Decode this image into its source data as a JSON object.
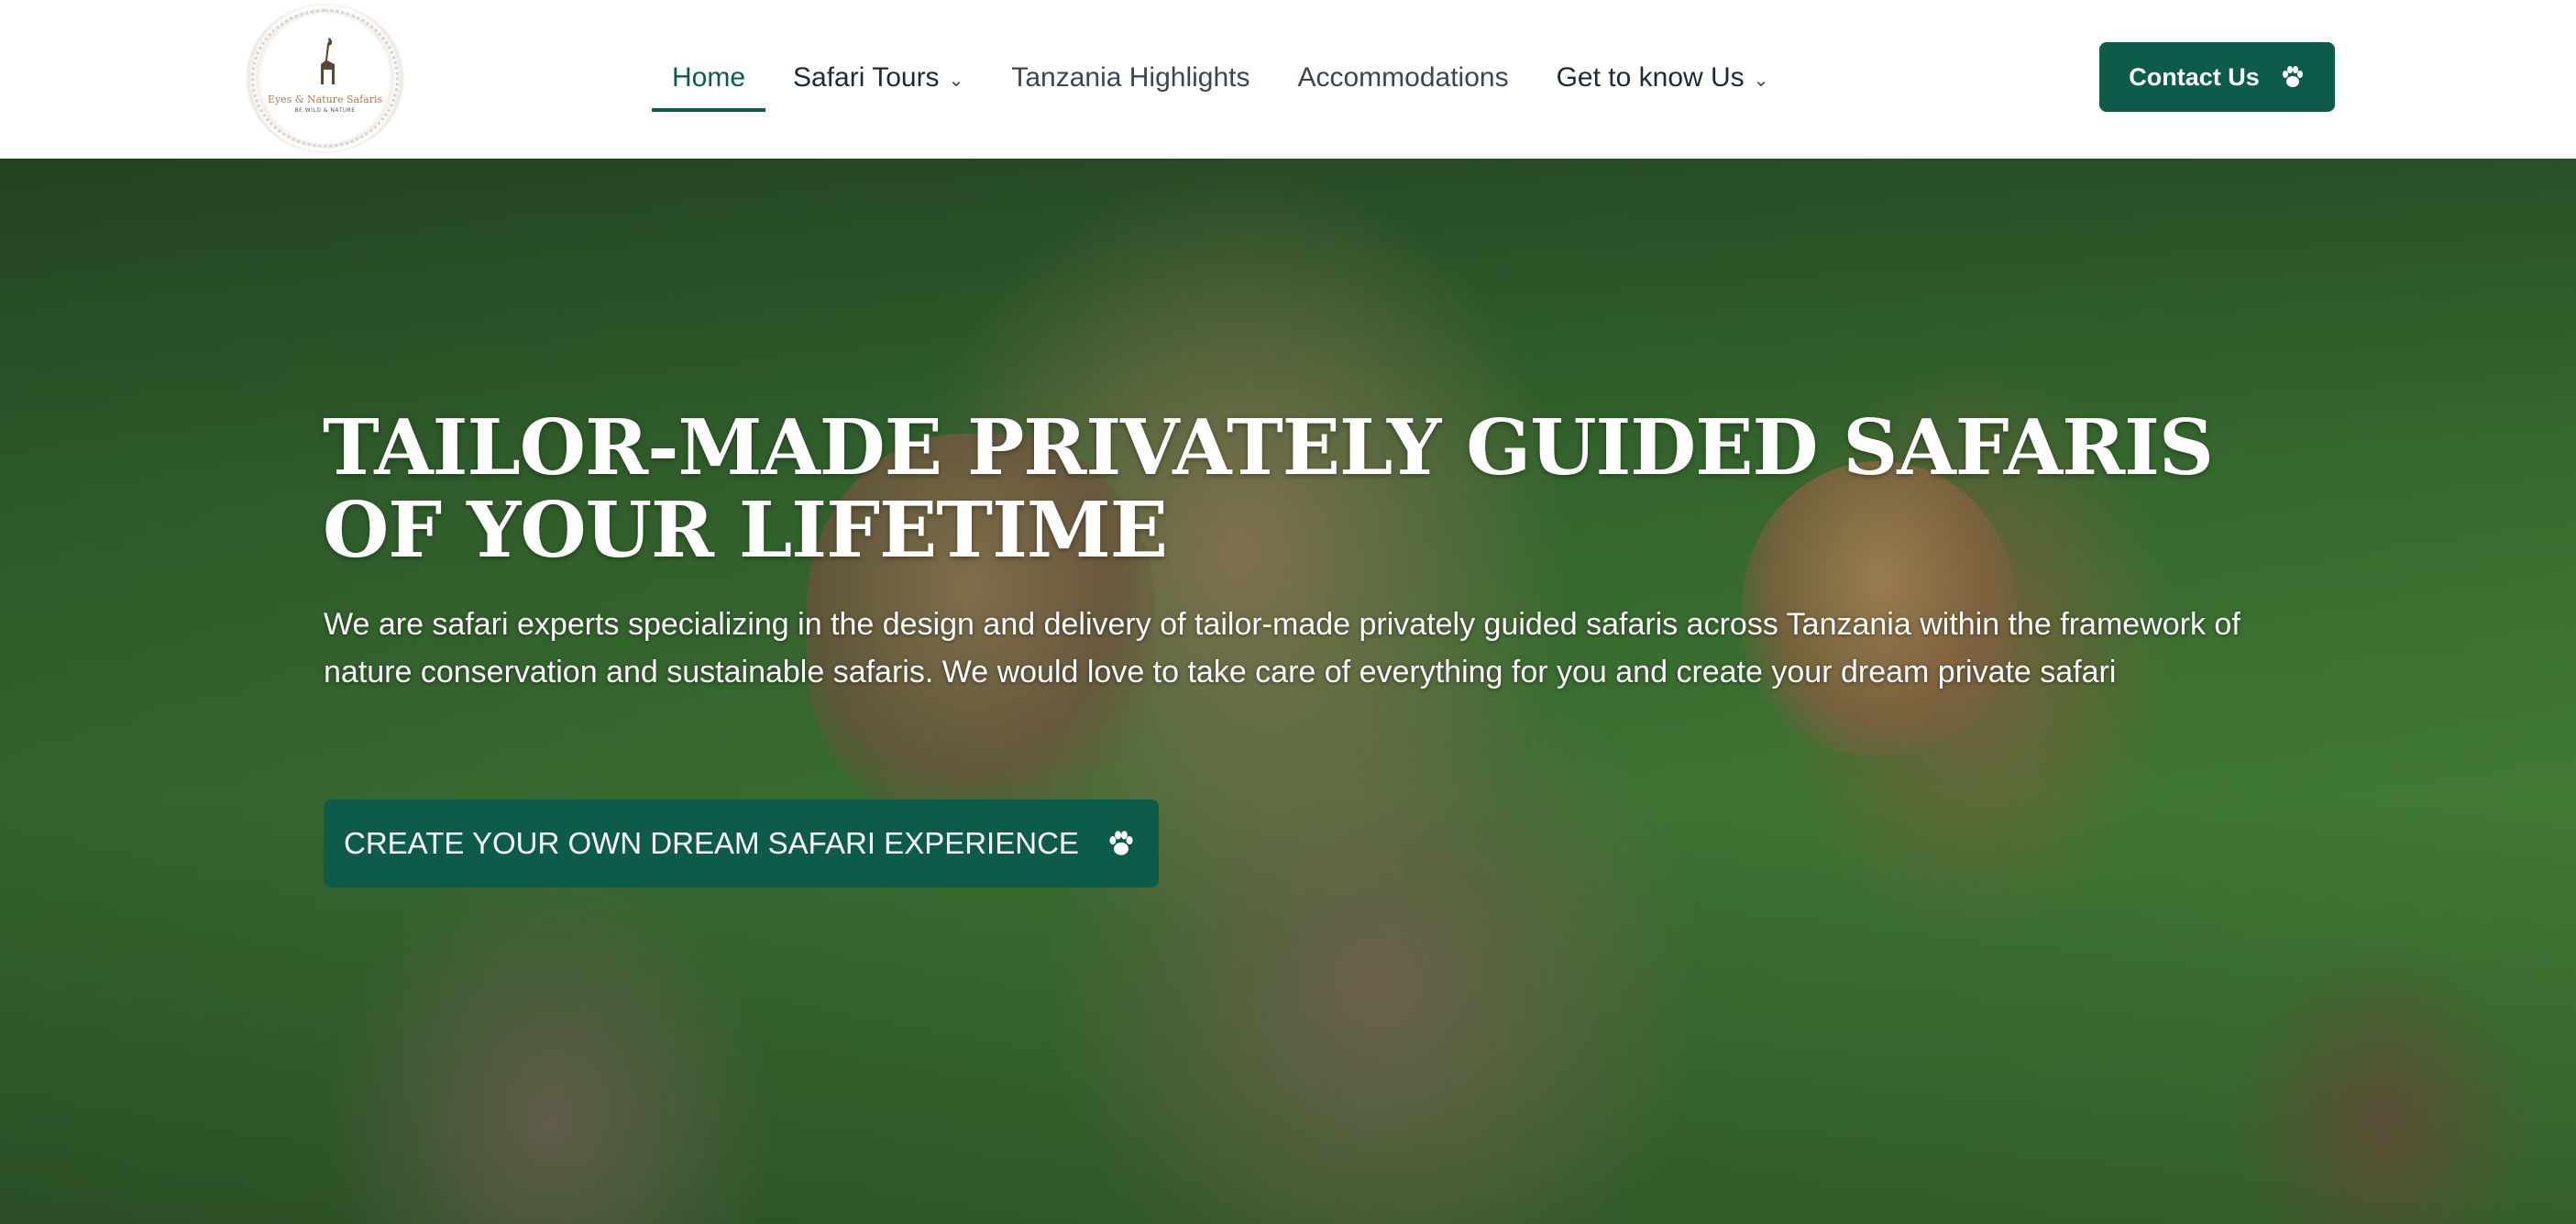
{
  "brand": {
    "logo_name": "Eyes & Nature Safaris",
    "logo_tagline": "BE WILD & NATURE"
  },
  "nav": {
    "items": [
      {
        "label": "Home",
        "active": true,
        "dropdown": false
      },
      {
        "label": "Safari Tours",
        "active": false,
        "dropdown": true
      },
      {
        "label": "Tanzania Highlights",
        "active": false,
        "dropdown": false
      },
      {
        "label": "Accommodations",
        "active": false,
        "dropdown": false
      },
      {
        "label": "Get to know Us",
        "active": false,
        "dropdown": true
      }
    ],
    "dropdown_glyph": "⌄",
    "contact_label": "Contact Us"
  },
  "hero": {
    "title": "TAILOR-MADE PRIVATELY GUIDED SAFARIS OF YOUR LIFETIME",
    "text": "We are safari experts specializing in the design and delivery of tailor-made privately guided safaris across Tanzania within the framework of nature conservation and sustainable safaris. We would love to take care of everything for you and create your dream private safari",
    "cta_label": "CREATE YOUR OWN DREAM SAFARI EXPERIENCE"
  },
  "colors": {
    "accent": "#0d5c4a",
    "text_dark": "#1f2a33",
    "white": "#ffffff"
  },
  "icons": {
    "contact": "paw-icon",
    "cta": "paw-icon",
    "logo": "giraffe-icon"
  }
}
